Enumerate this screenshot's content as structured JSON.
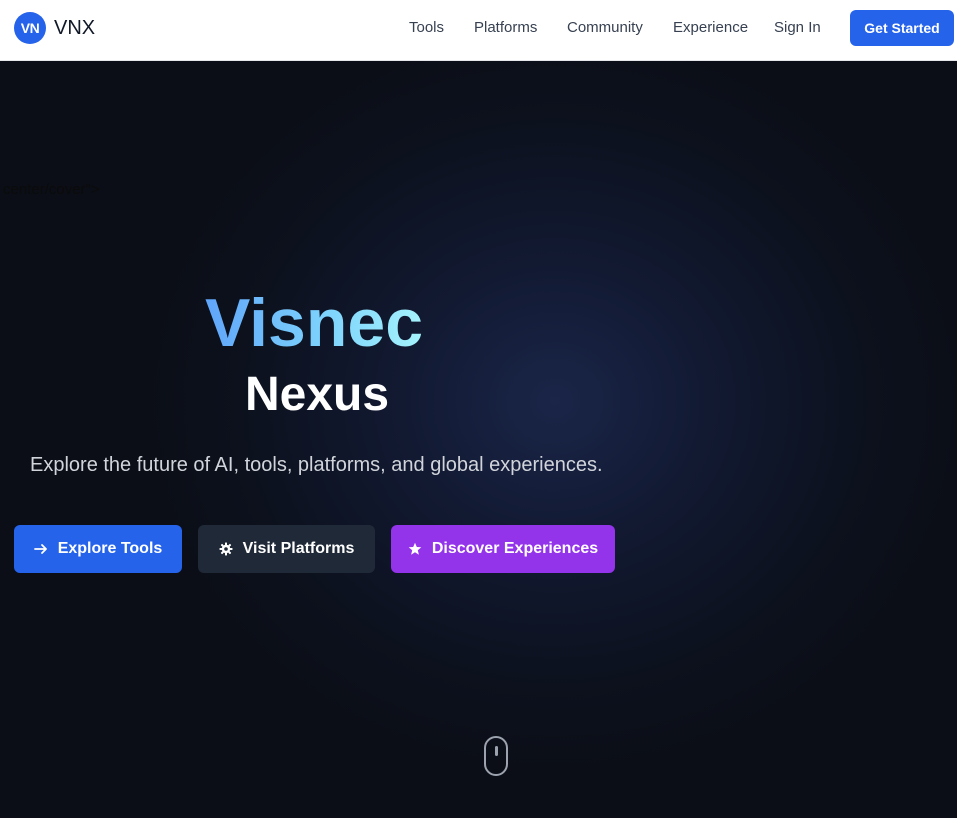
{
  "nav": {
    "logo_badge": "VN",
    "logo_text": "VNX",
    "links": [
      "Tools",
      "Platforms",
      "Community",
      "Experience",
      "Sign In"
    ],
    "cta": "Get Started"
  },
  "hero": {
    "stray_text": "center/cover\">",
    "title_line1": "Visnec",
    "title_line2": "Nexus",
    "subtitle": "Explore the future of AI, tools, platforms, and global experiences.",
    "buttons": [
      {
        "label": "Explore Tools",
        "icon": "arrow-right-icon"
      },
      {
        "label": "Visit Platforms",
        "icon": "gear-icon"
      },
      {
        "label": "Discover Experiences",
        "icon": "star-icon"
      }
    ]
  },
  "colors": {
    "primary": "#2563eb",
    "dark_button": "#1f2937",
    "purple": "#9333ea",
    "hero_bg": "#0c111d"
  }
}
